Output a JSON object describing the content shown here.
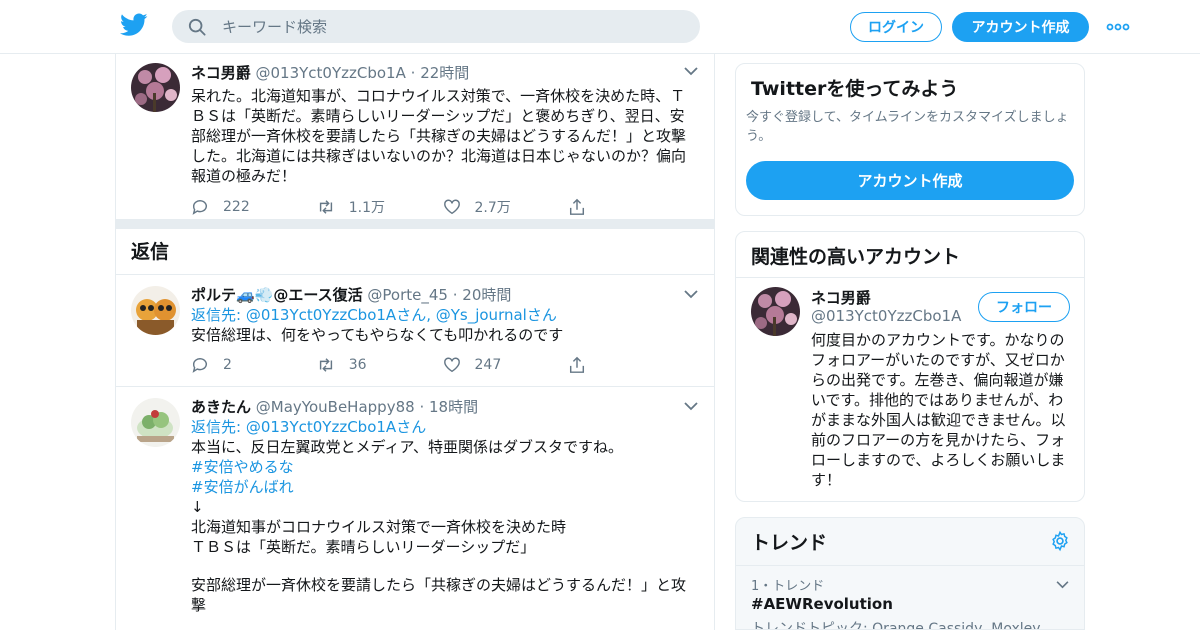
{
  "header": {
    "search_placeholder": "キーワード検索",
    "login_label": "ログイン",
    "signup_label": "アカウント作成"
  },
  "main_tweet": {
    "name": "ネコ男爵",
    "handle": "@013Yct0YzzCbo1A",
    "time": "22時間",
    "text": "呆れた。北海道知事が、コロナウイルス対策で、一斉休校を決めた時、ＴＢＳは「英断だ。素晴らしいリーダーシップだ」と褒めちぎり、翌日、安部総理が一斉休校を要請したら「共稼ぎの夫婦はどうするんだ！」と攻撃した。北海道には共稼ぎはいないのか？北海道は日本じゃないのか？偏向報道の極みだ！",
    "replies": "222",
    "retweets": "1.1万",
    "likes": "2.7万"
  },
  "replies_section_title": "返信",
  "replies": [
    {
      "name": "ポルテ🚙💨@エース復活",
      "handle": "@Porte_45",
      "time": "20時間",
      "reply_prefix": "返信先: ",
      "reply_to_1": "@013Yct0YzzCbo1A",
      "reply_suffix_1": "さん, ",
      "reply_to_2": "@Ys_journal",
      "reply_suffix_2": "さん",
      "text": "安倍総理は、何をやってもやらなくても叩かれるのです",
      "replies": "2",
      "retweets": "36",
      "likes": "247"
    },
    {
      "name": "あきたん",
      "handle": "@MayYouBeHappy88",
      "time": "18時間",
      "reply_prefix": "返信先: ",
      "reply_to_1": "@013Yct0YzzCbo1A",
      "reply_suffix_1": "さん",
      "line1": "本当に、反日左翼政党とメディア、特亜関係はダブスタですね。",
      "hashtag1": "#安倍やめるな",
      "hashtag2": "#安倍がんばれ",
      "arrow": "↓",
      "line2": "北海道知事がコロナウイルス対策で一斉休校を決めた時",
      "line3": "ＴＢＳは「英断だ。素晴らしいリーダーシップだ」",
      "line4": "安部総理が一斉休校を要請したら「共稼ぎの夫婦はどうするんだ！」と攻撃"
    }
  ],
  "signup_card": {
    "title": "Twitterを使ってみよう",
    "desc": "今すぐ登録して、タイムラインをカスタマイズしましょう。",
    "button": "アカウント作成"
  },
  "related_card": {
    "title": "関連性の高いアカウント",
    "name": "ネコ男爵",
    "handle": "@013Yct0YzzCbo1A",
    "follow": "フォロー",
    "bio": "何度目かのアカウントです。かなりのフォロアーがいたのですが、又ゼロからの出発です。左巻き、偏向報道が嫌いです。排他的ではありませんが、わがままな外国人は歓迎できません。以前のフロアーの方を見かけたら、フォローしますので、よろしくお願いします！"
  },
  "trends_card": {
    "title": "トレンド",
    "item_meta": "1・トレンド",
    "item_name": "#AEWRevolution",
    "item_topics": "トレンドトピック: Orange Cassidy, Moxley,"
  },
  "colors": {
    "accent": "#1da1f2",
    "link": "#1b95e0",
    "muted": "#657786",
    "border": "#e6ecf0"
  }
}
